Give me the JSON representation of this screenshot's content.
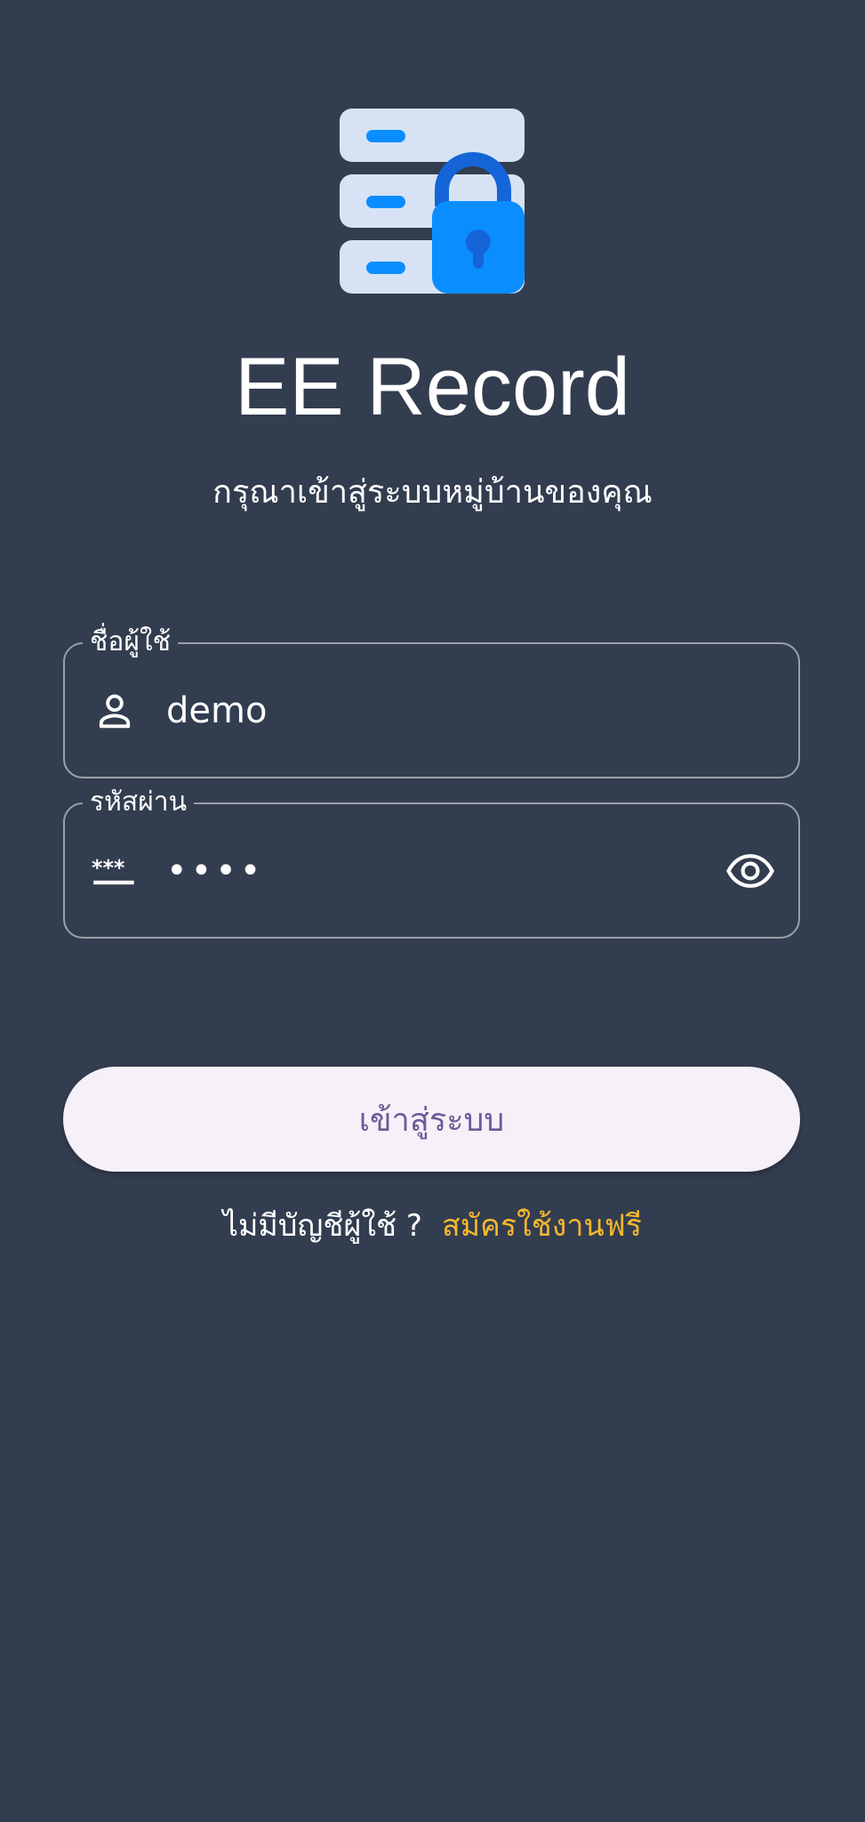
{
  "app": {
    "title": "EE Record",
    "subtitle": "กรุณาเข้าสู่ระบบหมู่บ้านของคุณ"
  },
  "form": {
    "username": {
      "label": "ชื่อผู้ใช้",
      "value": "demo",
      "icon": "person-icon"
    },
    "password": {
      "label": "รหัสผ่าน",
      "value": "••••",
      "icon": "password-icon",
      "toggle_icon": "eye-icon"
    },
    "submit_label": "เข้าสู่ระบบ"
  },
  "signup": {
    "prompt": "ไม่มีบัญชีผู้ใช้ ?",
    "link": "สมัครใช้งานฟรี"
  },
  "colors": {
    "background": "#333d50",
    "accent_link": "#f5b82e",
    "button_bg": "#f6f0f8",
    "button_text": "#6a5b97",
    "lock_blue": "#0a8eff"
  }
}
